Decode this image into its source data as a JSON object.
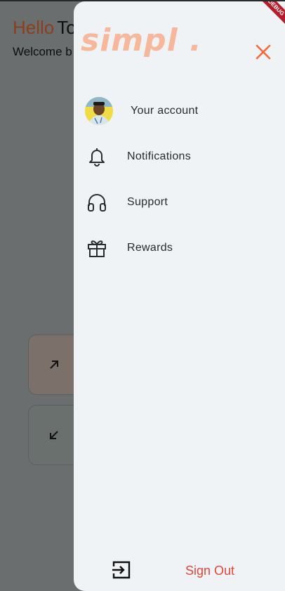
{
  "background": {
    "greeting_hello": "Hello",
    "greeting_name": "To",
    "welcome_text": "Welcome b",
    "card_up_icon": "arrow-up-right-icon",
    "card_down_icon": "arrow-down-left-icon"
  },
  "drawer": {
    "logo": "simpl .",
    "close_icon": "close-icon",
    "menu": [
      {
        "label": "Your account",
        "icon": "avatar"
      },
      {
        "label": "Notifications",
        "icon": "bell-icon"
      },
      {
        "label": "Support",
        "icon": "headphones-icon"
      },
      {
        "label": "Rewards",
        "icon": "gift-icon"
      }
    ],
    "sign_out_label": "Sign Out",
    "sign_out_icon": "logout-icon"
  },
  "debug_banner": "DEBUG",
  "colors": {
    "accent": "#f26b3a",
    "logo": "#f7b79b",
    "sign_out": "#e0463a",
    "drawer_bg": "#eff3f6",
    "scrim": "#6b6e6e"
  }
}
